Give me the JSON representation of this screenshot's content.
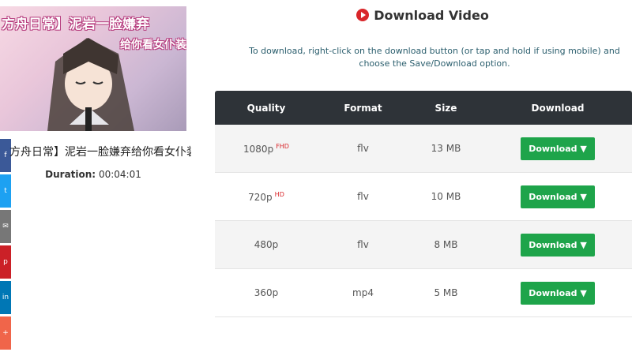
{
  "video": {
    "thumb_line1": "方舟日常】泥岩一脸嫌弃",
    "thumb_line2": "给你看女仆装",
    "title": "方舟日常】泥岩一脸嫌弃给你看女仆装",
    "duration_label": "Duration:",
    "duration_value": "00:04:01"
  },
  "share": [
    {
      "icon": "facebook-icon",
      "color": "#3b5998"
    },
    {
      "icon": "twitter-icon",
      "color": "#1da1f2"
    },
    {
      "icon": "email-icon",
      "color": "#777777"
    },
    {
      "icon": "pinterest-icon",
      "color": "#cb2027"
    },
    {
      "icon": "linkedin-icon",
      "color": "#0077b5"
    },
    {
      "icon": "more-share-icon",
      "color": "#f0654a"
    }
  ],
  "download": {
    "heading": "Download Video",
    "instructions": "To download, right-click on the download button (or tap and hold if using mobile) and choose the Save/Download option.",
    "columns": [
      "Quality",
      "Format",
      "Size",
      "Download"
    ],
    "rows": [
      {
        "quality": "1080p",
        "badge": "FHD",
        "format": "flv",
        "size": "13 MB",
        "button": "Download ▼"
      },
      {
        "quality": "720p",
        "badge": "HD",
        "format": "flv",
        "size": "10 MB",
        "button": "Download ▼"
      },
      {
        "quality": "480p",
        "badge": "",
        "format": "flv",
        "size": "8 MB",
        "button": "Download ▼"
      },
      {
        "quality": "360p",
        "badge": "",
        "format": "mp4",
        "size": "5 MB",
        "button": "Download ▼"
      }
    ]
  },
  "colors": {
    "download_button": "#1ea44a",
    "header_bg": "#2e3338",
    "accent_red": "#d9262a"
  }
}
